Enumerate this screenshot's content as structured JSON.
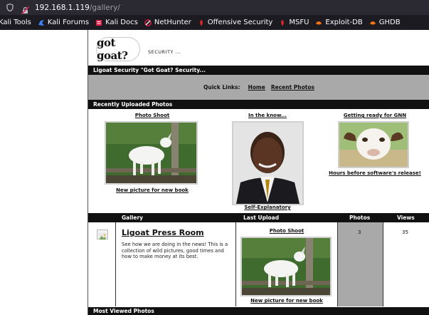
{
  "browser": {
    "url_host": "192.168.1.119",
    "url_path": "/gallery/",
    "bookmarks": [
      {
        "label": "Kali Tools",
        "color": "#3b82f6"
      },
      {
        "label": "Kali Forums",
        "color": "#3b82f6"
      },
      {
        "label": "Kali Docs",
        "color": "#e11d48"
      },
      {
        "label": "NetHunter",
        "color": "#e11d48"
      },
      {
        "label": "Offensive Security",
        "color": "#dc2626"
      },
      {
        "label": "MSFU",
        "color": "#dc2626"
      },
      {
        "label": "Exploit-DB",
        "color": "#f97316"
      },
      {
        "label": "GHDB",
        "color": "#f97316"
      }
    ]
  },
  "site": {
    "logo_text": "got goat?",
    "tagline": "SECURITY ...",
    "title": "Ligoat Security \"Got Goat? Security...",
    "quick_links_label": "Quick Links:",
    "quick_links": [
      "Home",
      "Recent Photos"
    ],
    "recent_header": "Recently Uploaded Photos",
    "recent_photos": [
      {
        "title": "Photo Shoot",
        "caption": "New picture for new book",
        "icon": "white-goat-photo"
      },
      {
        "title": "In the know...",
        "caption": "Self-Explanatory",
        "icon": "portrait-photo"
      },
      {
        "title": "Getting ready for GNN",
        "caption": "Hours before software's release!",
        "icon": "goat-closeup-photo"
      }
    ],
    "table_headers": {
      "gallery": "Gallery",
      "last_upload": "Last Upload",
      "photos": "Photos",
      "views": "Views"
    },
    "gallery_row": {
      "title": "Ligoat Press Room",
      "description": "See how we are doing in the news! This is a collection of wild pictures, good times and how to make money at its best.",
      "last_upload_title": "Photo Shoot",
      "last_upload_caption": "New picture for new book",
      "photos": "3",
      "views": "35"
    },
    "most_viewed_header": "Most Viewed Photos"
  }
}
